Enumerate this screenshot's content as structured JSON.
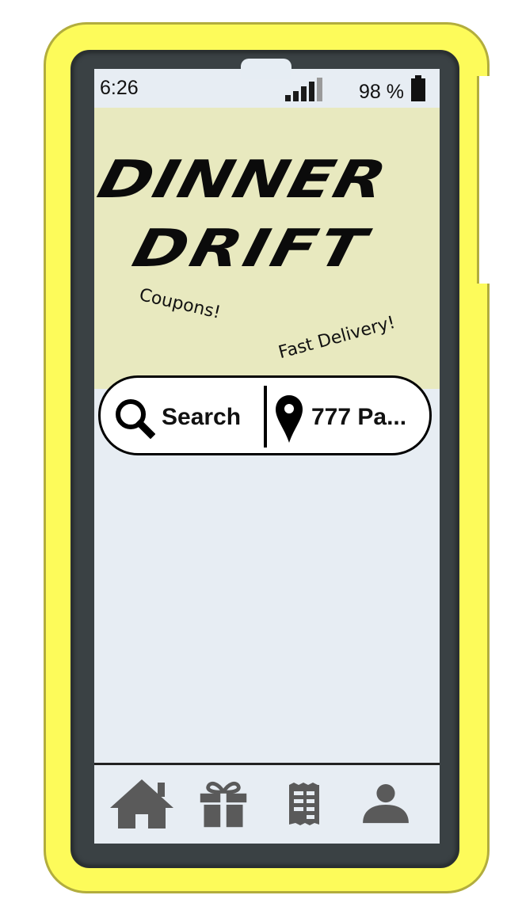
{
  "status_bar": {
    "time": "6:26",
    "battery": "98 %"
  },
  "banner": {
    "logo_line_1": "DINNER",
    "logo_line_2": "DRIFT",
    "tagline_1": "Coupons!",
    "tagline_2": "Fast Delivery!"
  },
  "search_bar": {
    "search_label": "Search",
    "location_label": "777 Pa..."
  },
  "bottom_nav": {
    "items": [
      {
        "icon": "home-icon"
      },
      {
        "icon": "gift-icon"
      },
      {
        "icon": "orders-icon"
      },
      {
        "icon": "profile-icon"
      }
    ]
  },
  "colors": {
    "case": "#fdfb5a",
    "case_outline": "#b2ad3d",
    "bezel": "#3a4144",
    "screen": "#e7edf3",
    "banner": "#e8e9bf",
    "nav_icon": "#5a5a5a"
  }
}
